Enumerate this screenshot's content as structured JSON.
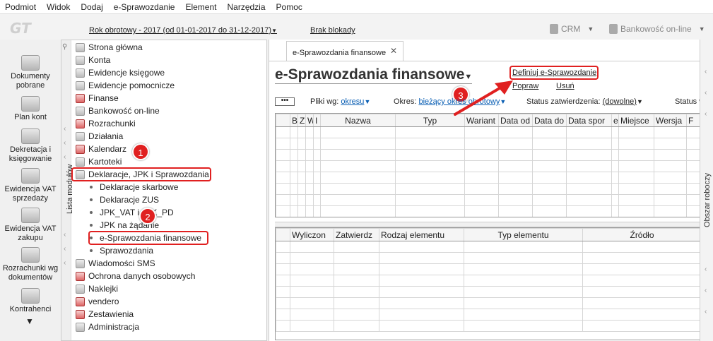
{
  "menu": [
    "Podmiot",
    "Widok",
    "Dodaj",
    "e-Sprawozdanie",
    "Element",
    "Narzędzia",
    "Pomoc"
  ],
  "topbar": {
    "period": "Rok obrotowy - 2017  (od 01-01-2017 do 31-12-2017)",
    "lock": "Brak blokady",
    "crm": "CRM",
    "bank": "Bankowość on-line"
  },
  "leftbar": [
    {
      "label": "Dokumenty pobrane"
    },
    {
      "label": "Plan kont"
    },
    {
      "label": "Dekretacja i księgowanie"
    },
    {
      "label": "Ewidencja VAT sprzedaży"
    },
    {
      "label": "Ewidencja VAT zakupu"
    },
    {
      "label": "Rozrachunki wg dokumentów"
    },
    {
      "label": "Kontrahenci"
    }
  ],
  "modules": {
    "title": "Lista modułów",
    "items": [
      {
        "label": "Strona główna",
        "level": 0
      },
      {
        "label": "Konta",
        "level": 0
      },
      {
        "label": "Ewidencje księgowe",
        "level": 0
      },
      {
        "label": "Ewidencje pomocnicze",
        "level": 0
      },
      {
        "label": "Finanse",
        "level": 0
      },
      {
        "label": "Bankowość on-line",
        "level": 0
      },
      {
        "label": "Rozrachunki",
        "level": 0
      },
      {
        "label": "Działania",
        "level": 0
      },
      {
        "label": "Kalendarz",
        "level": 0
      },
      {
        "label": "Kartoteki",
        "level": 0
      },
      {
        "label": "Deklaracje, JPK i Sprawozdania",
        "level": 0
      },
      {
        "label": "Deklaracje skarbowe",
        "level": 1
      },
      {
        "label": "Deklaracje ZUS",
        "level": 1
      },
      {
        "label": "JPK_VAT i JPK_PD",
        "level": 1
      },
      {
        "label": "JPK na żądanie",
        "level": 1
      },
      {
        "label": "e-Sprawozdania finansowe",
        "level": 1
      },
      {
        "label": "Sprawozdania",
        "level": 1
      },
      {
        "label": "Wiadomości SMS",
        "level": 0
      },
      {
        "label": "Ochrona danych osobowych",
        "level": 0
      },
      {
        "label": "Naklejki",
        "level": 0
      },
      {
        "label": "vendero",
        "level": 0
      },
      {
        "label": "Zestawienia",
        "level": 0
      },
      {
        "label": "Administracja",
        "level": 0
      }
    ]
  },
  "badges": [
    "1",
    "2",
    "3"
  ],
  "main": {
    "tab_label": "e-Sprawozdania finansowe",
    "title": "e-Sprawozdania finansowe",
    "actions": {
      "define": "Definiuj e-Sprawozdanie",
      "fix": "Popraw",
      "delete": "Usuń"
    },
    "dots": "•••",
    "filters": {
      "files_label": "Pliki wg:",
      "files_value": "okresu",
      "period_label": "Okres:",
      "period_value": "bieżący okres obrotowy",
      "approval_label": "Status zatwierdzenia:",
      "approval_value": "(dowolne)",
      "status_label": "Status wy"
    },
    "grid1_headers": [
      "",
      "B",
      "Z",
      "W",
      "I",
      "Nazwa",
      "Typ",
      "Wariant",
      "Data od",
      "Data do",
      "Data spor",
      "e",
      "Miejsce",
      "Wersja",
      "F"
    ],
    "grid2_headers": [
      "",
      "Wyliczon",
      "Zatwierdz",
      "Rodzaj elementu",
      "Typ elementu",
      "Źródło"
    ]
  },
  "right_panel": "Obszar roboczy"
}
